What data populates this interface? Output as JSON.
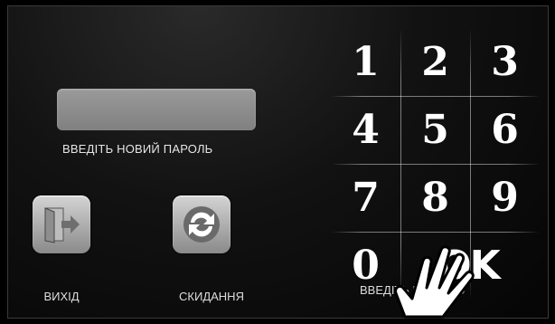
{
  "password": {
    "value": "",
    "hint": "ВВЕДІТЬ НОВИЙ ПАРОЛЬ"
  },
  "buttons": {
    "exit_label": "ВИХІД",
    "reset_label": "СКИДАННЯ"
  },
  "keypad": {
    "keys": [
      "1",
      "2",
      "3",
      "4",
      "5",
      "6",
      "7",
      "8",
      "9",
      "0"
    ],
    "ok_label": "OK",
    "bottom_label": "ВВЕДІТЬ ПАРОЛЮ"
  },
  "icons": {
    "exit": "exit-door-icon",
    "reset": "reset-arrows-icon",
    "pointer": "hand-pointer-icon"
  },
  "colors": {
    "background": "#000000",
    "text": "#ffffff",
    "button": "#b8b8b8"
  }
}
